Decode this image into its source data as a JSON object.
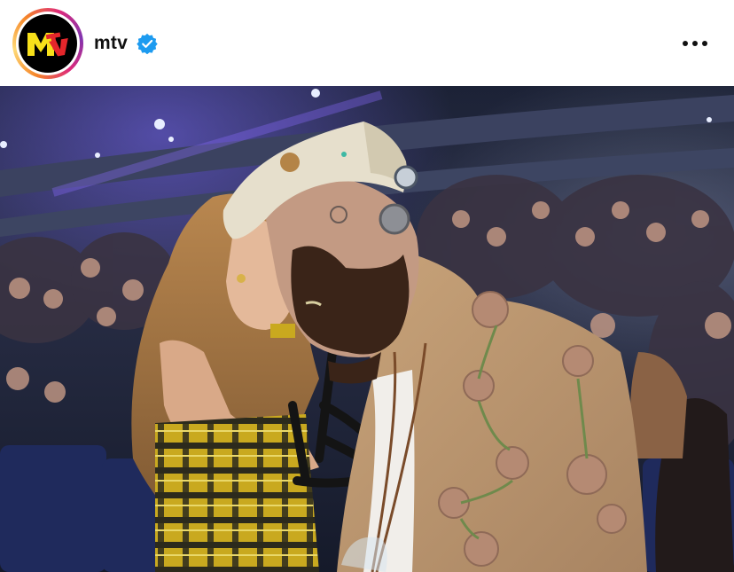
{
  "header": {
    "username": "mtv",
    "avatar_icon": "mtv-logo-icon",
    "verified_icon": "verified-badge-icon",
    "more_icon": "more-options-icon"
  },
  "colors": {
    "verified": "#1d9bf0",
    "logo_yellow": "#f7e01a",
    "logo_red": "#e4262b",
    "ring_orange": "#f58529",
    "ring_magenta": "#dd2a7b"
  },
  "post": {
    "image_icon": "post-photo-image"
  }
}
